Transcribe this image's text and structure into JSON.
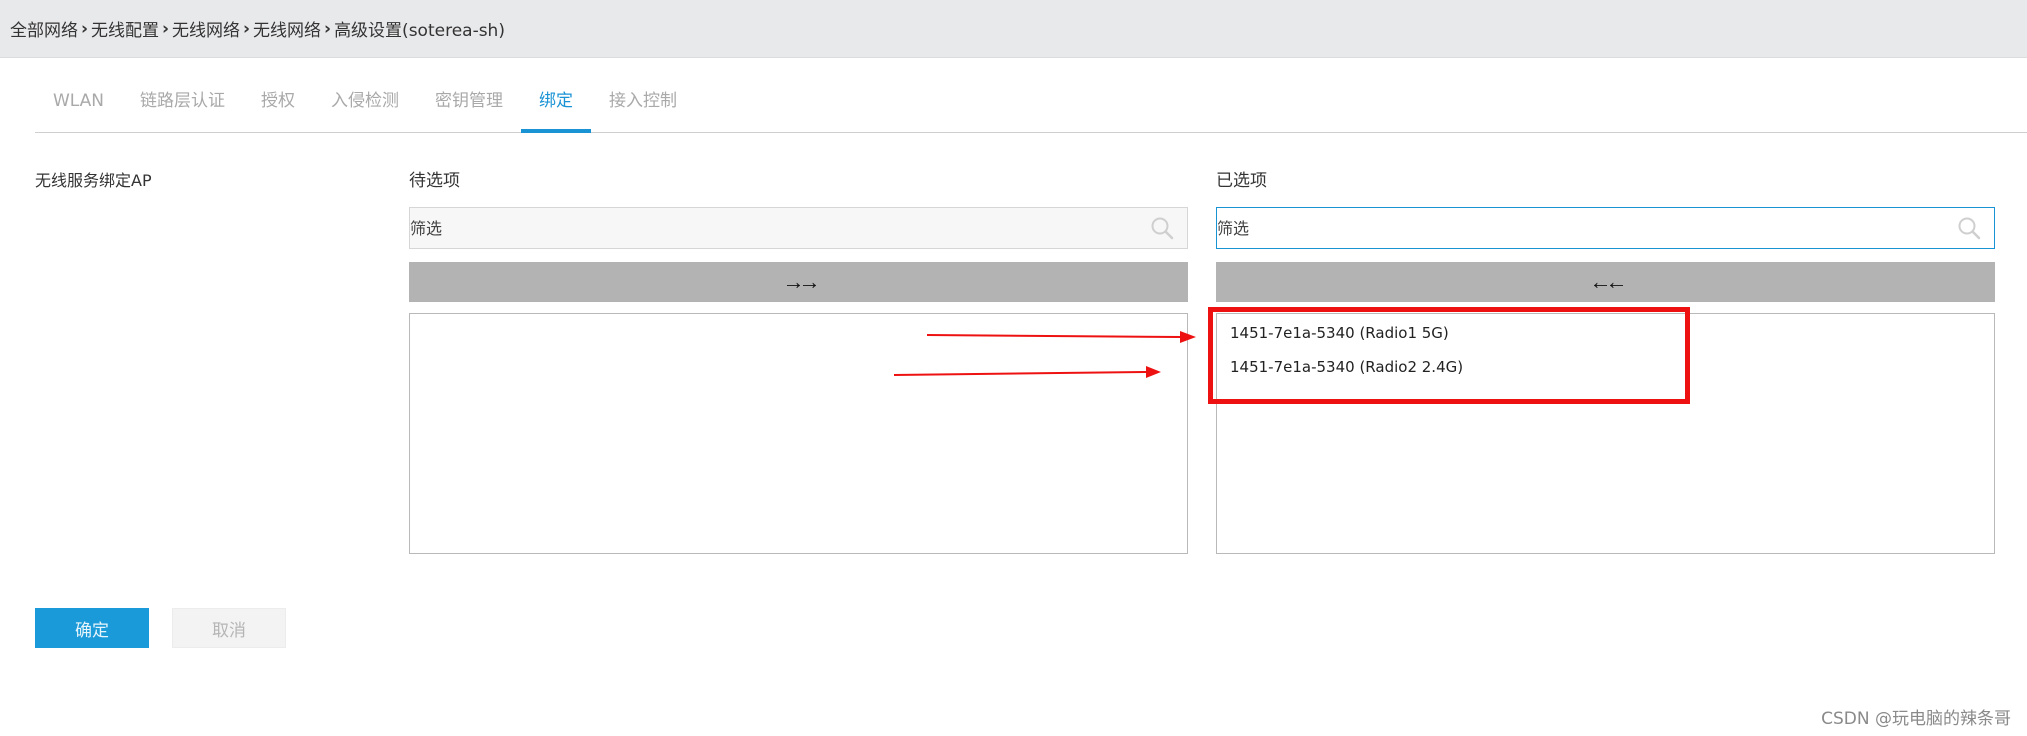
{
  "breadcrumb": {
    "items": [
      "全部网络",
      "无线配置",
      "无线网络",
      "无线网络",
      "高级设置(soterea-sh)"
    ]
  },
  "tabs": [
    {
      "label": "WLAN",
      "active": false
    },
    {
      "label": "链路层认证",
      "active": false
    },
    {
      "label": "授权",
      "active": false
    },
    {
      "label": "入侵检测",
      "active": false
    },
    {
      "label": "密钥管理",
      "active": false
    },
    {
      "label": "绑定",
      "active": true
    },
    {
      "label": "接入控制",
      "active": false
    }
  ],
  "form": {
    "field_label": "无线服务绑定AP",
    "available": {
      "title": "待选项",
      "filter_placeholder": "筛选",
      "move_button": "→→",
      "items": []
    },
    "selected": {
      "title": "已选项",
      "filter_placeholder": "筛选",
      "move_button": "←←",
      "items": [
        "1451-7e1a-5340 (Radio1 5G)",
        "1451-7e1a-5340 (Radio2 2.4G)"
      ]
    }
  },
  "actions": {
    "confirm_label": "确定",
    "cancel_label": "取消"
  },
  "watermark": "CSDN @玩电脑的辣条哥",
  "colors": {
    "accent": "#1a93d5",
    "annotation": "#ee1111",
    "move_button_bg": "#b3b3b3"
  }
}
